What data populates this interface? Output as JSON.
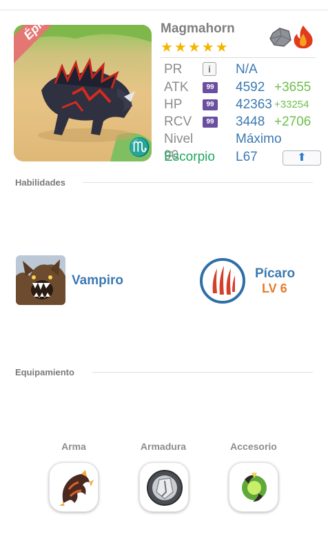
{
  "monster": {
    "name": "Magmahorn",
    "rarity": "Épico",
    "stars": "★★★★★",
    "elements": [
      "rock-element-icon",
      "fire-element-icon"
    ],
    "zodiac_glyph": "♏"
  },
  "stats": {
    "pr": {
      "label": "PR",
      "value": "N/A"
    },
    "atk": {
      "label": "ATK",
      "badge": "99",
      "value": "4592",
      "bonus": "+3655"
    },
    "hp": {
      "label": "HP",
      "badge": "99",
      "value": "42363",
      "bonus": "+33254"
    },
    "rcv": {
      "label": "RCV",
      "badge": "99",
      "value": "3448",
      "bonus": "+2706"
    },
    "level": {
      "label": "Nivel 90",
      "value": "Máximo"
    },
    "sign": {
      "label": "Escorpio",
      "value": "L67"
    }
  },
  "sections": {
    "abilities": "Habilidades",
    "equipment": "Equipamiento"
  },
  "abilities": {
    "passive_name": "Vampiro",
    "skill_name": "Pícaro",
    "skill_level": "LV 6"
  },
  "equipment": {
    "weapon": "Arma",
    "armor": "Armadura",
    "accessory": "Accesorio"
  },
  "colors": {
    "value_blue": "#3b79b2",
    "bonus_green": "#6dbe4a",
    "zodiac_green": "#20a85c",
    "level_orange": "#e57b2c",
    "star_gold": "#f4b400",
    "rarity_ribbon": "#e47773"
  }
}
